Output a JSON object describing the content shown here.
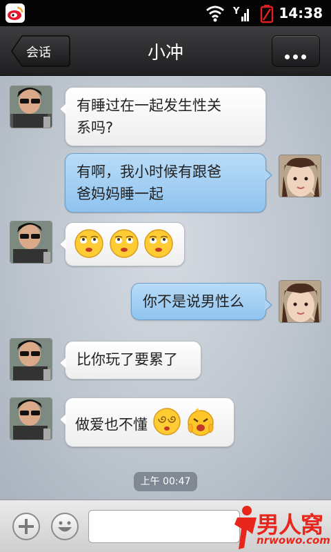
{
  "status_bar": {
    "time": "14:38",
    "app_icon": "weibo-icon",
    "icons": [
      "wifi-icon",
      "signal-icon",
      "battery-low-icon"
    ],
    "battery_color": "#e02020"
  },
  "header": {
    "back_label": "会话",
    "title": "小冲",
    "more_icon": "more-dots-icon"
  },
  "messages": [
    {
      "side": "left",
      "text_lines": [
        "有睡过在一起发生性关",
        "系吗?"
      ]
    },
    {
      "side": "right",
      "text_lines": [
        "有啊，我小时候有跟爸",
        "爸妈妈睡一起"
      ]
    },
    {
      "side": "left",
      "emojis": [
        "rolling-eyes-emoji",
        "rolling-eyes-emoji",
        "rolling-eyes-emoji"
      ]
    },
    {
      "side": "right",
      "text": "你不是说男性么"
    },
    {
      "side": "left",
      "text": "比你玩了要累了"
    },
    {
      "side": "left",
      "text": "做爱也不懂",
      "emojis": [
        "dizzy-emoji",
        "crying-emoji"
      ]
    }
  ],
  "timestamp": "上午 00:47",
  "input_bar": {
    "add_icon": "plus-icon",
    "emoji_icon": "smiley-icon",
    "input_value": "",
    "watermark": {
      "title": "男人窝",
      "subtitle": "nrwowo.com"
    }
  },
  "colors": {
    "left_bubble": "#ffffff",
    "right_bubble": "#a8d2f5",
    "header_bg": "#2b2b2d",
    "watermark": "#e8261b"
  }
}
